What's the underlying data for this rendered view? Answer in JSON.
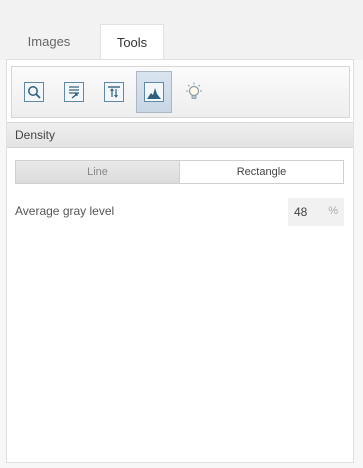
{
  "tabs": [
    {
      "label": "Images"
    },
    {
      "label": "Tools"
    }
  ],
  "toolbar": {
    "tools": [
      {
        "icon": "zoom-select-icon"
      },
      {
        "icon": "export-profile-icon"
      },
      {
        "icon": "align-top-icon"
      },
      {
        "icon": "density-histogram-icon"
      },
      {
        "icon": "light-bulb-icon"
      }
    ],
    "active_index": 3
  },
  "section": {
    "title": "Density"
  },
  "mode_toggle": {
    "options": [
      "Line",
      "Rectangle"
    ],
    "selected": "Rectangle"
  },
  "measurement": {
    "label": "Average gray level",
    "value": "48",
    "unit": "%"
  }
}
